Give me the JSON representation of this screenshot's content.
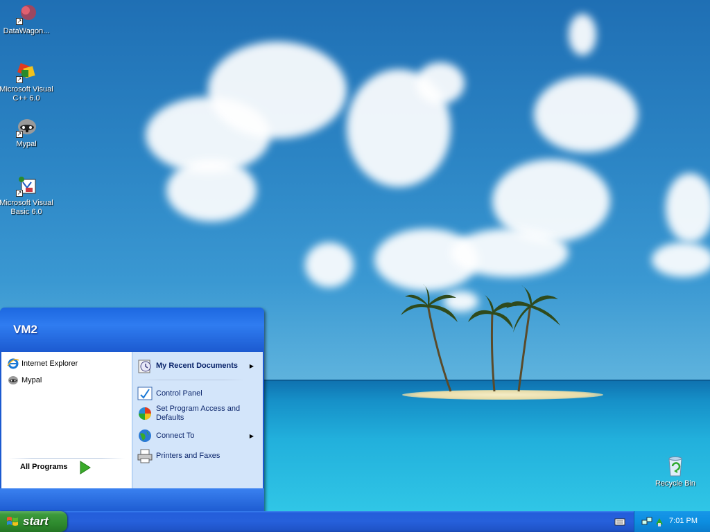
{
  "desktop": {
    "icons": [
      {
        "label": "DataWagon..."
      },
      {
        "label": "Microsoft Visual C++ 6.0"
      },
      {
        "label": "Mypal"
      },
      {
        "label": "Microsoft Visual Basic 6.0"
      },
      {
        "label": "Recycle Bin"
      }
    ]
  },
  "start_menu": {
    "user": "VM2",
    "pinned": [
      {
        "label": "Internet Explorer",
        "icon": "internet-explorer-icon"
      },
      {
        "label": "Mypal",
        "icon": "mypal-icon"
      }
    ],
    "all_programs": "All Programs",
    "right_items": [
      {
        "label": "My Recent Documents",
        "icon": "recent-documents-icon",
        "submenu": true
      },
      {
        "label": "Control Panel",
        "icon": "control-panel-icon",
        "submenu": false
      },
      {
        "label": "Set Program Access and Defaults",
        "icon": "program-access-icon",
        "submenu": false
      },
      {
        "label": "Connect To",
        "icon": "connect-to-icon",
        "submenu": true
      },
      {
        "label": "Printers and Faxes",
        "icon": "printer-icon",
        "submenu": false
      }
    ]
  },
  "taskbar": {
    "start_label": "start",
    "clock": "7:01 PM"
  },
  "colors": {
    "taskbar_blue": "#245edb",
    "start_green": "#3c9a3c",
    "tray_blue": "#0d8ee0",
    "menu_right_panel": "#d3e5fa"
  }
}
